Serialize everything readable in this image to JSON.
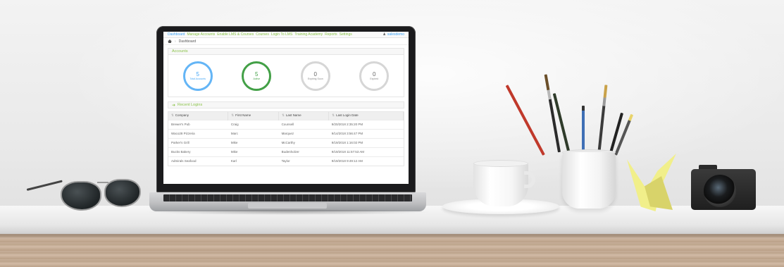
{
  "app": {
    "nav": [
      {
        "label": "Dashboard",
        "active": true
      },
      {
        "label": "Manage Accounts",
        "active": false
      },
      {
        "label": "Enable LMS & Courses",
        "active": false
      },
      {
        "label": "Courses",
        "active": false
      },
      {
        "label": "Login To LMS",
        "active": false
      },
      {
        "label": "Training Academy",
        "active": false
      },
      {
        "label": "Reports",
        "active": false
      },
      {
        "label": "Settings",
        "active": false
      }
    ],
    "user": "salesdemo",
    "breadcrumb": "Dashboard",
    "accounts": {
      "title": "Accounts",
      "stats": [
        {
          "value": "5",
          "label": "Total Accounts",
          "color": "#64b5f6"
        },
        {
          "value": "5",
          "label": "Active",
          "color": "#43a047"
        },
        {
          "value": "0",
          "label": "Expiring Soon",
          "color": "#d6d6d6"
        },
        {
          "value": "0",
          "label": "Expired",
          "color": "#d6d6d6"
        }
      ]
    },
    "recent_logins": {
      "title": "Recent Logins",
      "columns": [
        "Company",
        "First Name",
        "Last Name",
        "Last Login Date"
      ],
      "rows": [
        [
          "Brewer's Pub",
          "Craig",
          "Counsell",
          "9/20/2018 2:35:20 PM"
        ],
        [
          "Waco28 Pizzeria",
          "Marc",
          "Marquez",
          "9/14/2018 3:56:47 PM"
        ],
        [
          "Parker's Grill",
          "Mike",
          "McCarthy",
          "9/19/2018 1:16:02 PM"
        ],
        [
          "Bucks Bakery",
          "Mike",
          "Budenholzer",
          "9/19/2018 11:57:53 AM"
        ],
        [
          "Admirals Seafood",
          "Karl",
          "Taylor",
          "9/19/2018 9:49:12 AM"
        ]
      ]
    }
  },
  "colors": {
    "accent_green": "#8bc34a",
    "link_blue": "#42a5f5"
  }
}
